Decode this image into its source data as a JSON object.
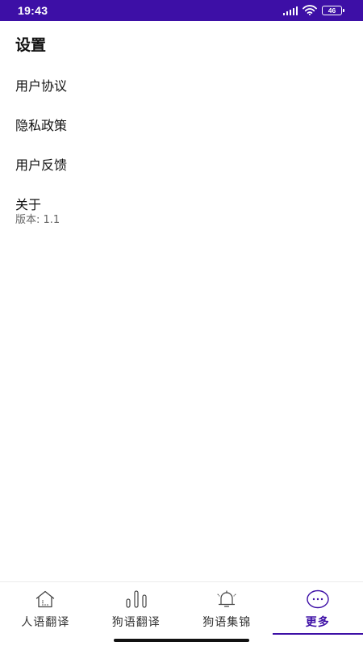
{
  "status_bar": {
    "time": "19:43",
    "battery": "46"
  },
  "page": {
    "title": "设置"
  },
  "menu": {
    "items": [
      {
        "label": "用户协议"
      },
      {
        "label": "隐私政策"
      },
      {
        "label": "用户反馈"
      },
      {
        "label": "关于"
      }
    ],
    "about_version": "版本: 1.1"
  },
  "bottom_nav": {
    "tabs": [
      {
        "label": "人语翻译",
        "icon": "house-icon"
      },
      {
        "label": "狗语翻译",
        "icon": "bars-icon"
      },
      {
        "label": "狗语集锦",
        "icon": "bell-icon"
      },
      {
        "label": "更多",
        "icon": "more-icon"
      }
    ],
    "active_index": 3
  },
  "colors": {
    "accent": "#3d0fa6",
    "status_bar": "#3d0fa6",
    "text": "#111111",
    "secondary_text": "#666666"
  }
}
